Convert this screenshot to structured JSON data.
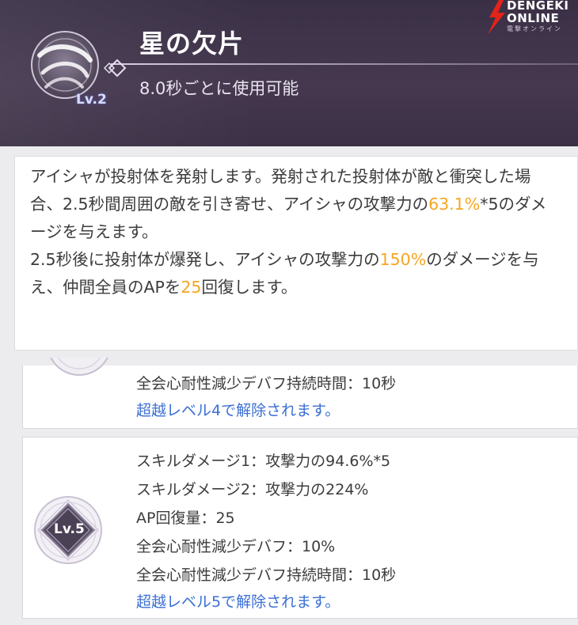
{
  "header": {
    "title": "星の欠片",
    "level_badge": "Lv.2",
    "cooldown": "8.0秒ごとに使用可能"
  },
  "watermark": {
    "line1": "DENGEKI",
    "line2": "ONLINE",
    "line3": "電撃オンライン"
  },
  "description": {
    "p1": "アイシャが投射体を発射します。発射された投射体が敵と衝突した場合、2.5秒間周囲の敵を引き寄せ、アイシャの攻撃力の",
    "p1_hl": "63.1%",
    "p1_tail": "*5のダメージを与えます。",
    "p2": "2.5秒後に投射体が爆発し、アイシャの攻撃力の",
    "p2_hl": "150%",
    "p2_mid": "のダメージを与え、仲間全員のAPを",
    "p2_hl2": "25",
    "p2_tail": "回復します。"
  },
  "level4": {
    "duration": "全会心耐性減少デバフ持続時間：10秒",
    "unlock": "超越レベル4で解除されます。"
  },
  "level5": {
    "badge": "Lv.5",
    "skill_damage_1": "スキルダメージ1：攻撃力の94.6%*5",
    "skill_damage_2": "スキルダメージ2：攻撃力の224%",
    "ap_recovery": "AP回復量：25",
    "crit_resist_debuff": "全会心耐性減少デバフ：10%",
    "duration": "全会心耐性減少デバフ持続時間：10秒",
    "unlock": "超越レベル5で解除されます。"
  },
  "colors": {
    "header_bg": "#3a3046",
    "highlight": "#f5a623",
    "unlock_link": "#3b6fd4",
    "watermark_red": "#e2231a"
  }
}
